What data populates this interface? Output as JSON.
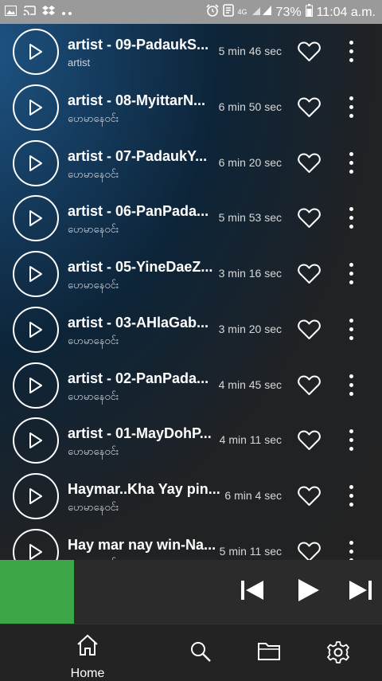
{
  "status_bar": {
    "battery": "73%",
    "time": "11:04 a.m.",
    "network": "4G",
    "left_icons": [
      "image-icon",
      "cast-icon",
      "dropbox-icon",
      "more-dots-icon"
    ],
    "right_icons": [
      "alarm-icon",
      "nfc-icon",
      "signal-icon",
      "battery-icon"
    ]
  },
  "tracks": [
    {
      "title": "artist - 09-PadaukS...",
      "artist": "artist",
      "duration": "5 min 46 sec"
    },
    {
      "title": "artist - 08-MyittarN...",
      "artist": "ဟေမာနေဝင်း",
      "duration": "6 min 50 sec"
    },
    {
      "title": "artist - 07-PadaukY...",
      "artist": "ဟေမာနေဝင်း",
      "duration": "6 min 20 sec"
    },
    {
      "title": "artist - 06-PanPada...",
      "artist": "ဟေမာနေဝင်း",
      "duration": "5 min 53 sec"
    },
    {
      "title": "artist - 05-YineDaeZ...",
      "artist": "ဟေမာနေဝင်း",
      "duration": "3 min 16 sec"
    },
    {
      "title": "artist - 03-AHlaGab...",
      "artist": "ဟေမာနေဝင်း",
      "duration": "3 min 20 sec"
    },
    {
      "title": "artist - 02-PanPada...",
      "artist": "ဟေမာနေဝင်း",
      "duration": "4 min 45 sec"
    },
    {
      "title": "artist - 01-MayDohP...",
      "artist": "ဟေမာနေဝင်း",
      "duration": "4 min 11 sec"
    },
    {
      "title": "Haymar..Kha Yay pin...",
      "artist": "ဟေမာနေဝင်း",
      "duration": "6 min 4 sec"
    },
    {
      "title": "Hay mar nay win-Na...",
      "artist": "ဟေမာနေဝင်း",
      "duration": "5 min 11 sec"
    }
  ],
  "player": {
    "art_color": "#3da646",
    "controls": [
      "previous-icon",
      "play-icon",
      "next-icon"
    ]
  },
  "nav": {
    "home_label": "Home",
    "items": [
      "home-icon",
      "search-icon",
      "folder-icon",
      "settings-icon"
    ]
  }
}
